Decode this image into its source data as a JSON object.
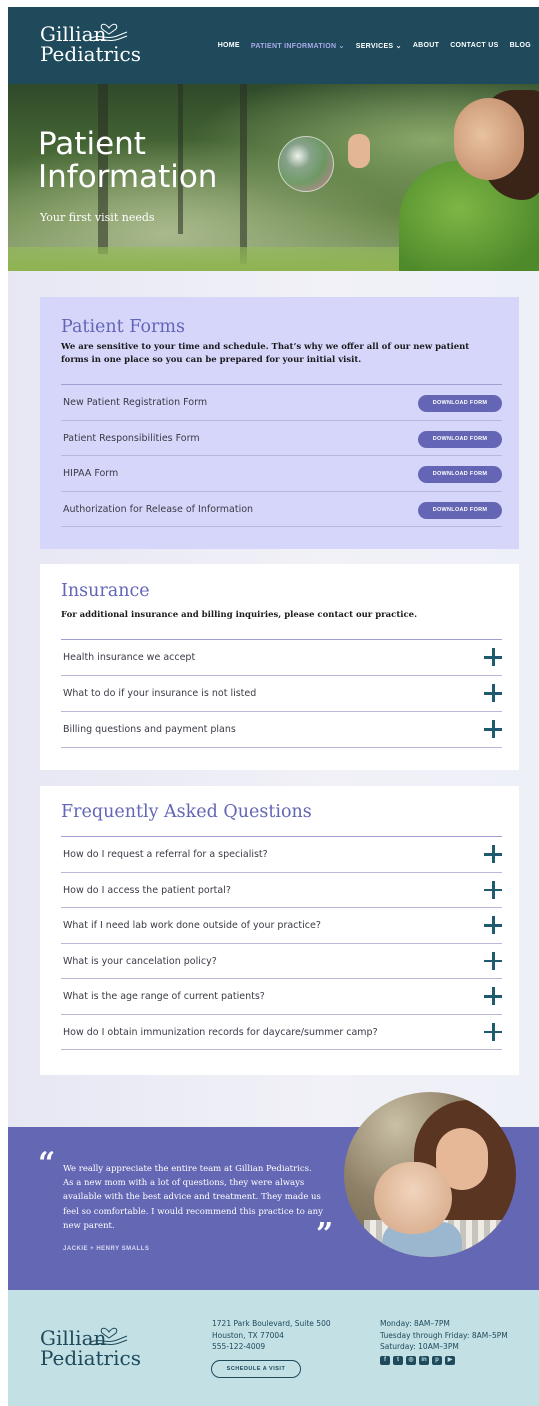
{
  "brand": {
    "line1": "Gillian",
    "line2": "Pediatrics"
  },
  "nav": {
    "items": [
      {
        "label": "HOME"
      },
      {
        "label": "PATIENT INFORMATION ⌄"
      },
      {
        "label": "SERVICES ⌄"
      },
      {
        "label": "ABOUT"
      },
      {
        "label": "CONTACT US"
      },
      {
        "label": "BLOG"
      }
    ],
    "active_index": 1
  },
  "hero": {
    "title_line1": "Patient",
    "title_line2": "Information",
    "subtitle": "Your first visit needs"
  },
  "forms": {
    "title": "Patient Forms",
    "intro": "We are sensitive to your time and schedule. That’s why we offer all of our new patient forms in one place so you can be prepared for your initial visit.",
    "button_label": "DOWNLOAD FORM",
    "items": [
      {
        "label": "New Patient Registration Form"
      },
      {
        "label": "Patient Responsibilities Form"
      },
      {
        "label": "HIPAA Form"
      },
      {
        "label": "Authorization for Release of Information"
      }
    ]
  },
  "insurance": {
    "title": "Insurance",
    "intro": "For additional insurance and billing inquiries, please contact our practice.",
    "items": [
      {
        "label": "Health insurance we accept"
      },
      {
        "label": "What to do if your insurance is not listed"
      },
      {
        "label": "Billing questions and payment plans"
      }
    ]
  },
  "faq": {
    "title": "Frequently Asked Questions",
    "items": [
      {
        "label": "How do I request a referral for a specialist?"
      },
      {
        "label": "How do I access the patient portal?"
      },
      {
        "label": "What if I need lab work done outside of your practice?"
      },
      {
        "label": "What is your cancelation policy?"
      },
      {
        "label": "What is the age range of current patients?"
      },
      {
        "label": "How do I obtain immunization records for daycare/summer camp?"
      }
    ]
  },
  "testimonial": {
    "open_quote": "“",
    "close_quote": "”",
    "quote": "We really appreciate the entire team at Gillian Pediatrics. As a new mom with a lot of questions, they were always available with the best advice and treatment. They made us feel so comfortable. I would recommend this practice to any new parent.",
    "author": "JACKIE + HENRY SMALLS"
  },
  "footer": {
    "address_line1": "1721 Park Boulevard, Suite 500",
    "address_line2": "Houston, TX 77004",
    "phone": "555-122-4009",
    "schedule_button": "SCHEDULE A VISIT",
    "hours_line1": "Monday: 8AM–7PM",
    "hours_line2": "Tuesday through Friday: 8AM–5PM",
    "hours_line3": "Saturday: 10AM–3PM",
    "social": [
      {
        "icon": "facebook-icon",
        "glyph": "f"
      },
      {
        "icon": "twitter-icon",
        "glyph": "t"
      },
      {
        "icon": "instagram-icon",
        "glyph": "◎"
      },
      {
        "icon": "linkedin-icon",
        "glyph": "in"
      },
      {
        "icon": "pinterest-icon",
        "glyph": "p"
      },
      {
        "icon": "youtube-icon",
        "glyph": "▶"
      }
    ]
  },
  "colors": {
    "header": "#1e4a5c",
    "accent": "#6466b5",
    "forms_bg": "#d6d6fb",
    "footer_bg": "#c3e0e5"
  }
}
